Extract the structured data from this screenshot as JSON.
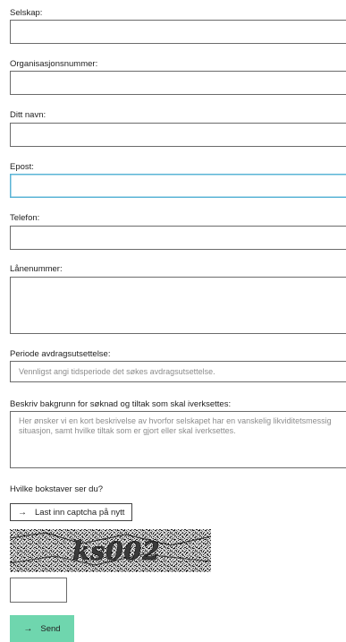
{
  "form": {
    "company_label": "Selskap:",
    "org_number_label": "Organisasjonsnummer:",
    "name_label": "Ditt navn:",
    "email_label": "Epost:",
    "phone_label": "Telefon:",
    "loan_number_label": "Lånenummer:",
    "deferral_period_label": "Periode avdragsutsettelse:",
    "deferral_period_placeholder": "Vennligst angi tidsperiode det søkes avdragsutsettelse.",
    "background_label": "Beskriv bakgrunn for søknad og tiltak som skal iverksettes:",
    "background_placeholder": "Her ønsker vi en kort beskrivelse av hvorfor selskapet har en vanskelig likviditetsmessig situasjon, samt hvilke tiltak som er gjort eller skal iverksettes."
  },
  "captcha": {
    "question_label": "Hvilke bokstaver ser du?",
    "reload_label": "Last inn captcha på nytt",
    "arrow_icon": "arrow-right-icon",
    "image_text": "ks002"
  },
  "submit": {
    "send_label": "Send",
    "arrow_icon": "arrow-right-icon",
    "color": "#6fd6ae"
  },
  "colors": {
    "focus_border": "#5ab4d6",
    "input_border": "#6b6b6b"
  }
}
